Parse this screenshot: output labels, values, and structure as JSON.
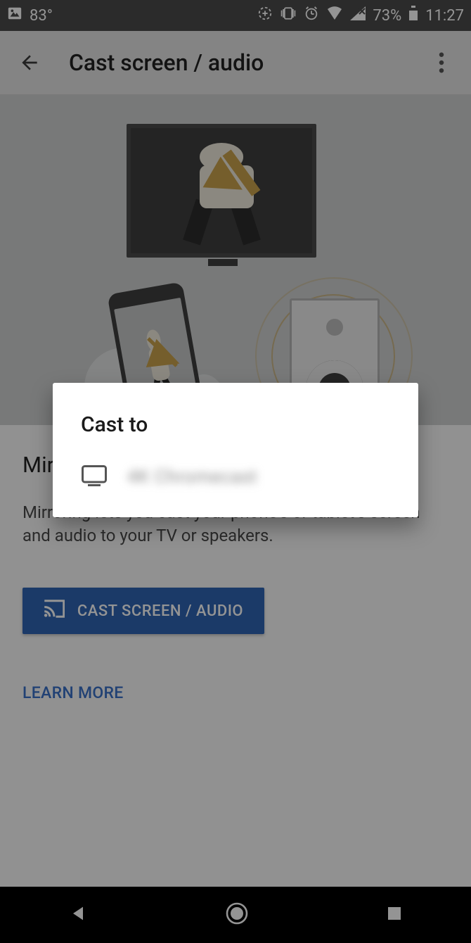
{
  "status": {
    "temperature": "83°",
    "battery_percent": "73%",
    "clock": "11:27"
  },
  "appbar": {
    "title": "Cast screen / audio"
  },
  "content": {
    "subhead": "Mirror your phone's screen and audio",
    "body": "Mirroring lets you cast your phone's or tablet's screen and audio to your TV or speakers.",
    "cast_button_label": "CAST SCREEN / AUDIO",
    "learn_more_label": "LEARN MORE"
  },
  "dialog": {
    "title": "Cast to",
    "devices": [
      {
        "name": "4K Chromecast"
      }
    ]
  },
  "colors": {
    "primary_button": "#2f64b4",
    "link": "#3a71c8"
  }
}
